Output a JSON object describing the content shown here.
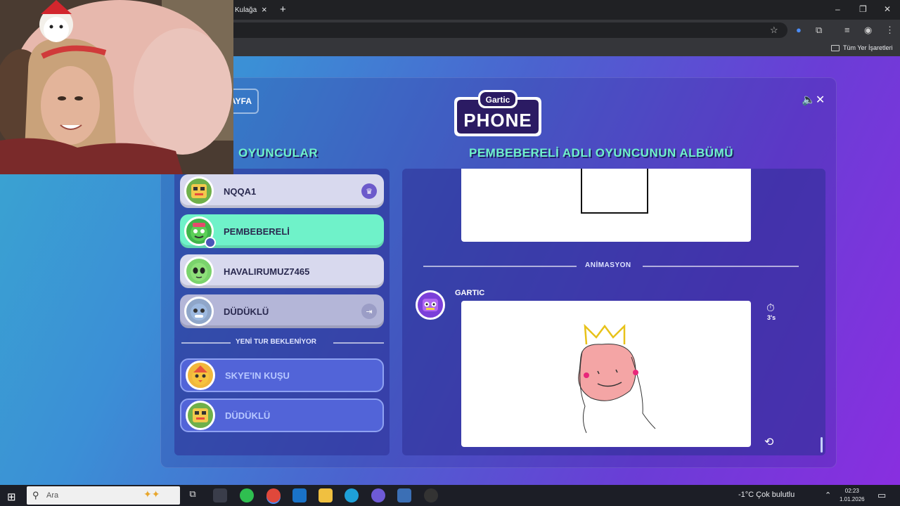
{
  "browser": {
    "tab_title": "Kulağa",
    "tab_close": "×",
    "new_tab": "+",
    "bookmarks_label": "Tüm Yer İşaretleri",
    "window_controls": [
      "–",
      "❐",
      "✕"
    ]
  },
  "game": {
    "back_button_fragment": "AYFA",
    "logo_top": "Gartic",
    "logo_bottom": "PHONE",
    "sound_icon": "speaker-muted-icon",
    "players_title": "OYUNCULAR",
    "album_title": "PEMBEBERELİ ADLI OYUNCUNUN ALBÜMÜ",
    "players": [
      {
        "name": "NQQA1",
        "badge": "crown-icon",
        "badge_glyph": "♛",
        "state": "host"
      },
      {
        "name": "PEMBEBERELİ",
        "badge": "user-icon",
        "state": "active"
      },
      {
        "name": "HAVALIRUMUZ7465",
        "badge": "",
        "state": "normal"
      },
      {
        "name": "DÜDÜKLÜ",
        "badge": "exit-icon",
        "badge_glyph": "⇥",
        "state": "dimmed"
      }
    ],
    "waiting_label": "YENİ TUR BEKLENİYOR",
    "waiting_players": [
      {
        "name": "SKYE'IN KUŞU"
      },
      {
        "name": "DÜDÜKLÜ"
      }
    ],
    "album": {
      "section_label": "ANİMASYON",
      "author": "GARTIC",
      "timer": "3's",
      "timer_icon": "stopwatch-icon",
      "loop_icon": "loop-icon"
    },
    "colors": {
      "accent_mint": "#6ff2c9",
      "panel_blue": "#2e3096",
      "waiting_blue": "#5264d8"
    }
  },
  "taskbar": {
    "search_placeholder": "Ara",
    "weather": "-1°C  Çok bulutlu",
    "time": "02:23",
    "date": "1.01.2026"
  }
}
